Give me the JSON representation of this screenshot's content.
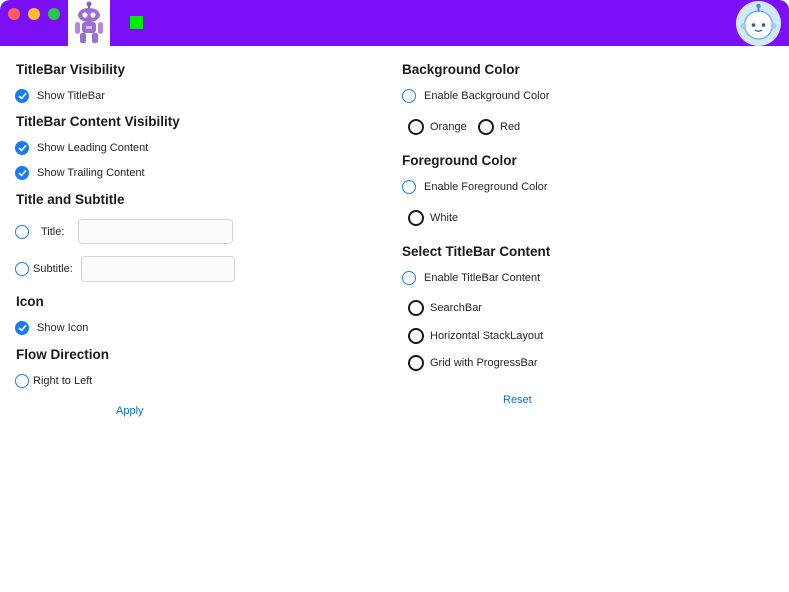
{
  "colors": {
    "titlebar_bg": "#7b10f7",
    "accent": "#1a7cf5",
    "link": "#0a6ad6"
  },
  "titlebar": {
    "leading_icon": "robot-mascot-icon",
    "trailing_icon": "bot-avatar-icon"
  },
  "left": {
    "visibility_heading": "TitleBar Visibility",
    "show_titlebar": "Show TitleBar",
    "content_visibility_heading": "TitleBar Content Visibility",
    "show_leading": "Show Leading Content",
    "show_trailing": "Show Trailing Content",
    "title_subtitle_heading": "Title and Subtitle",
    "title_label": "Title:",
    "title_value": "",
    "subtitle_label": "Subtitle:",
    "subtitle_value": "",
    "icon_heading": "Icon",
    "show_icon": "Show Icon",
    "flow_heading": "Flow Direction",
    "right_to_left": "Right to Left",
    "apply": "Apply"
  },
  "right": {
    "background_heading": "Background Color",
    "enable_background": "Enable Background Color",
    "orange": "Orange",
    "red": "Red",
    "foreground_heading": "Foreground Color",
    "enable_foreground": "Enable Foreground Color",
    "white": "White",
    "content_heading": "Select TitleBar Content",
    "enable_content": "Enable TitleBar Content",
    "searchbar": "SearchBar",
    "stacklayout": "Horizontal StackLayout",
    "grid_progress": "Grid with ProgressBar",
    "reset": "Reset"
  }
}
